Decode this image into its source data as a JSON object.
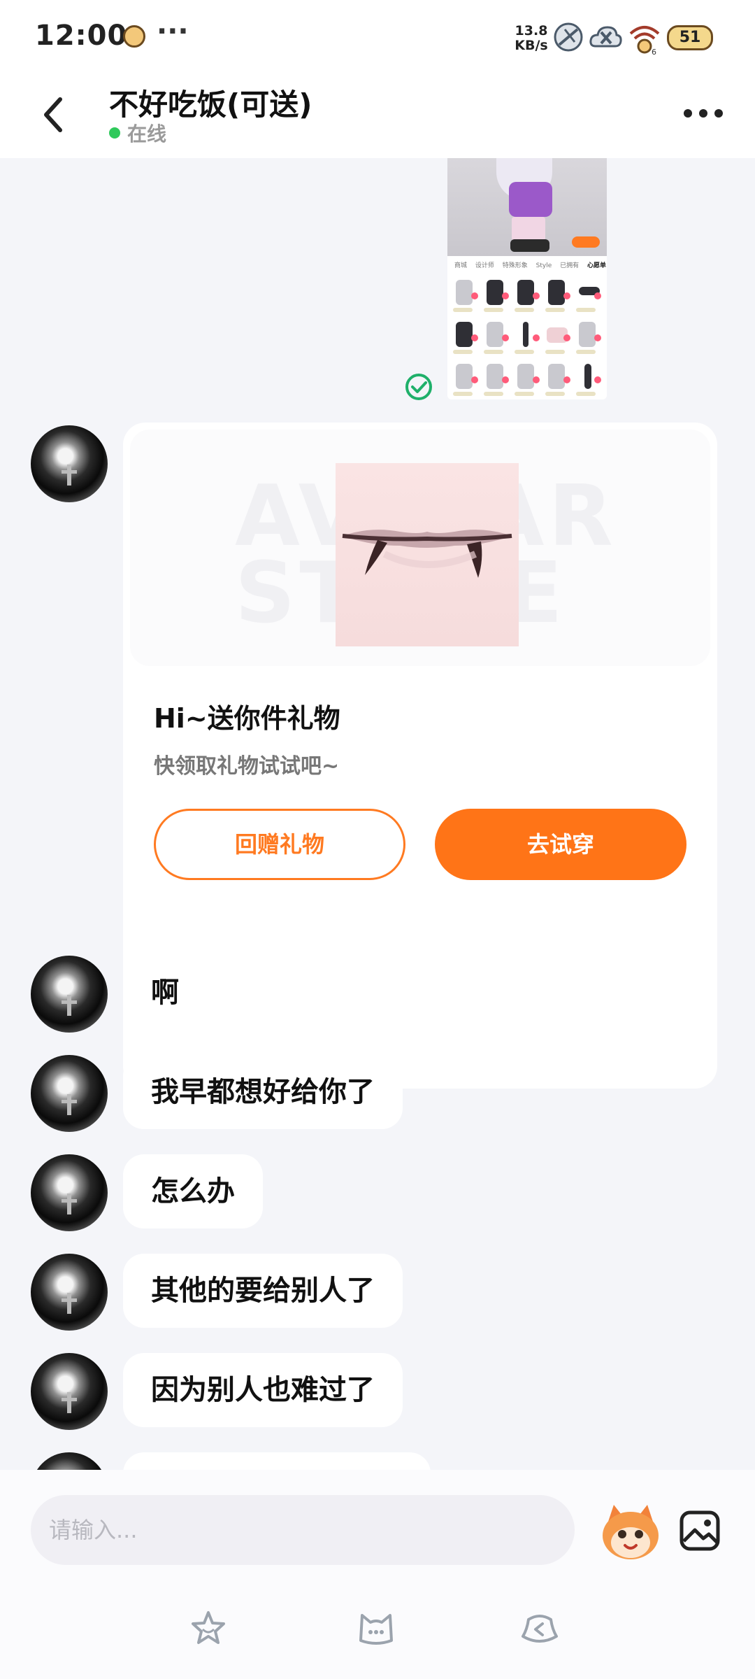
{
  "status_bar": {
    "time": "12:00",
    "more": "···",
    "net_speed_value": "13.8",
    "net_speed_unit": "KB/s",
    "battery": "51",
    "icons": [
      "weather-icon",
      "satellite-icon",
      "cloud-off-icon",
      "wifi-icon",
      "battery-icon"
    ]
  },
  "header": {
    "title": "不好吃饭(可送)",
    "status": "在线",
    "status_color": "#2fc95b"
  },
  "screenshot_thumbnail": {
    "tabs": [
      "商城",
      "设计师",
      "特殊形象",
      "Style",
      "已拥有",
      "心愿单"
    ],
    "active_tab": "心愿单"
  },
  "gift_card": {
    "watermark": "AVATAR STORE",
    "title": "Hi~送你件礼物",
    "subtitle": "快领取礼物试试吧~",
    "return_gift_label": "回赠礼物",
    "try_on_label": "去试穿",
    "accent_color": "#ff7417"
  },
  "messages": [
    {
      "text": "啊"
    },
    {
      "text": "我早都想好给你了"
    },
    {
      "text": "怎么办"
    },
    {
      "text": "其他的要给别人了"
    },
    {
      "text": "因为别人也难过了"
    }
  ],
  "input_bar": {
    "placeholder": "请输入...",
    "tools": [
      "star-icon",
      "cat-face-icon",
      "hat-icon"
    ]
  }
}
